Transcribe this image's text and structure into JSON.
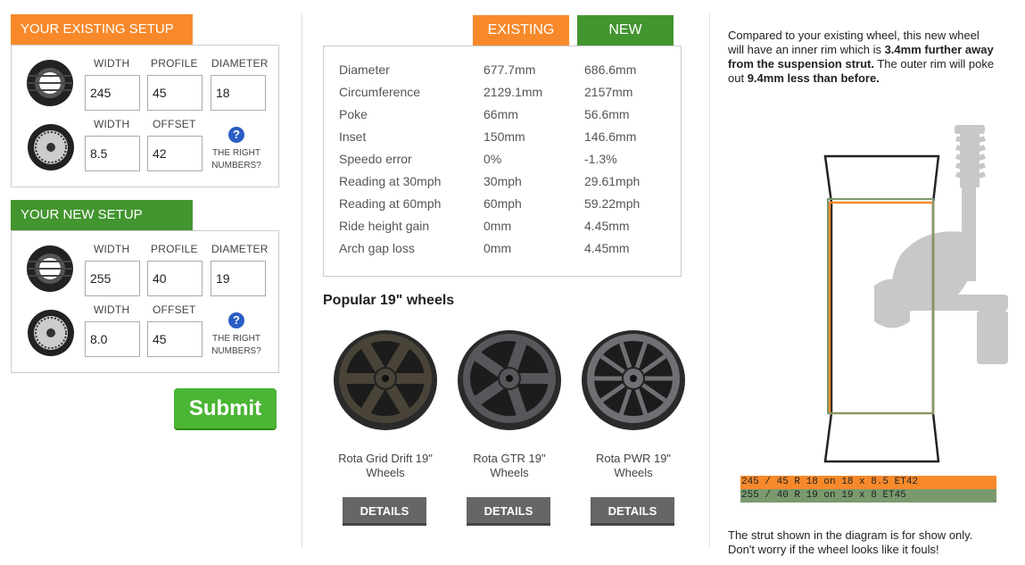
{
  "existing_setup": {
    "title": "YOUR EXISTING SETUP",
    "tyre_labels": [
      "WIDTH",
      "PROFILE",
      "DIAMETER"
    ],
    "tyre_values": [
      "245",
      "45",
      "18"
    ],
    "wheel_labels": [
      "WIDTH",
      "OFFSET"
    ],
    "wheel_values": [
      "8.5",
      "42"
    ],
    "help_text": "THE RIGHT NUMBERS?"
  },
  "new_setup": {
    "title": "YOUR NEW SETUP",
    "tyre_labels": [
      "WIDTH",
      "PROFILE",
      "DIAMETER"
    ],
    "tyre_values": [
      "255",
      "40",
      "19"
    ],
    "wheel_labels": [
      "WIDTH",
      "OFFSET"
    ],
    "wheel_values": [
      "8.0",
      "45"
    ],
    "help_text": "THE RIGHT NUMBERS?"
  },
  "submit_label": "Submit",
  "comparison": {
    "tab_existing": "EXISTING",
    "tab_new": "NEW",
    "rows": [
      {
        "label": "Diameter",
        "existing": "677.7mm",
        "new": "686.6mm"
      },
      {
        "label": "Circumference",
        "existing": "2129.1mm",
        "new": "2157mm"
      },
      {
        "label": "Poke",
        "existing": "66mm",
        "new": "56.6mm"
      },
      {
        "label": "Inset",
        "existing": "150mm",
        "new": "146.6mm"
      },
      {
        "label": "Speedo error",
        "existing": "0%",
        "new": "-1.3%"
      },
      {
        "label": "Reading at 30mph",
        "existing": "30mph",
        "new": "29.61mph"
      },
      {
        "label": "Reading at 60mph",
        "existing": "60mph",
        "new": "59.22mph"
      },
      {
        "label": "Ride height gain",
        "existing": "0mm",
        "new": "4.45mm"
      },
      {
        "label": "Arch gap loss",
        "existing": "0mm",
        "new": "4.45mm"
      }
    ]
  },
  "popular": {
    "title": "Popular 19\" wheels",
    "wheels": [
      {
        "name": "Rota Grid Drift 19\" Wheels",
        "details": "DETAILS",
        "color": "#4a4438"
      },
      {
        "name": "Rota GTR 19\" Wheels",
        "details": "DETAILS",
        "color": "#55575a"
      },
      {
        "name": "Rota PWR 19\" Wheels",
        "details": "DETAILS",
        "color": "#6e7074"
      }
    ]
  },
  "summary": {
    "t1": "Compared to your existing wheel, this new wheel will have an inner rim which is ",
    "b1": "3.4mm further away from the suspension strut.",
    "t2": " The outer rim will poke out ",
    "b2": "9.4mm less than before.",
    "legend_existing": "245 / 45 R 18 on 18 x 8.5 ET42",
    "legend_new": "255 / 40 R 19 on 19 x 8 ET45",
    "footnote": "The strut shown in the diagram is for show only. Don't worry if the wheel looks like it fouls!"
  },
  "colors": {
    "orange": "#f7892b",
    "green": "#43952f",
    "submit": "#4bb534",
    "existing_outline": "#f7892b",
    "new_outline": "#7a9a6e"
  }
}
